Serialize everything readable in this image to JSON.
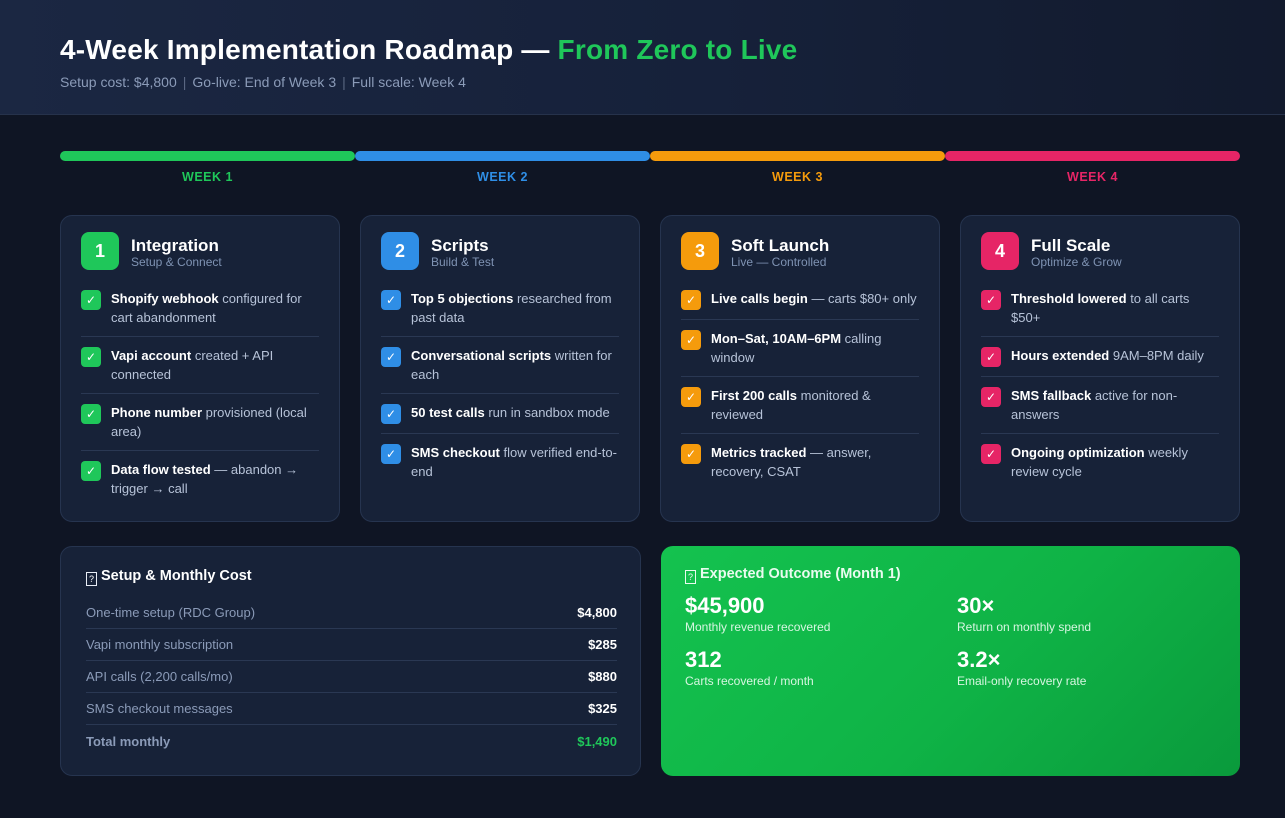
{
  "header": {
    "title_main": "4-Week Implementation Roadmap — ",
    "title_accent": "From Zero to Live",
    "subtitle_parts": [
      "Setup cost: $4,800",
      "Go-live: End of Week 3",
      "Full scale: Week 4"
    ],
    "separator": "|"
  },
  "timeline": [
    {
      "label": "WEEK 1",
      "color": "#1fc75a"
    },
    {
      "label": "WEEK 2",
      "color": "#2f8ee6"
    },
    {
      "label": "WEEK 3",
      "color": "#f59b0c"
    },
    {
      "label": "WEEK 4",
      "color": "#e62566"
    }
  ],
  "weeks": [
    {
      "number": "1",
      "title": "Integration",
      "subtitle": "Setup & Connect",
      "color": "#1fc75a",
      "check": "✓",
      "items": [
        {
          "bold": "Shopify webhook",
          "text": " configured for cart abandonment"
        },
        {
          "bold": "Vapi account",
          "text": " created + API connected"
        },
        {
          "bold": "Phone number",
          "text": " provisioned (local area)"
        },
        {
          "bold": "Data flow tested",
          "text": " — abandon → trigger → call"
        }
      ]
    },
    {
      "number": "2",
      "title": "Scripts",
      "subtitle": "Build & Test",
      "color": "#2f8ee6",
      "check": "✓",
      "items": [
        {
          "bold": "Top 5 objections",
          "text": " researched from past data"
        },
        {
          "bold": "Conversational scripts",
          "text": " written for each"
        },
        {
          "bold": "50 test calls",
          "text": " run in sandbox mode"
        },
        {
          "bold": "SMS checkout",
          "text": " flow verified end-to-end"
        }
      ]
    },
    {
      "number": "3",
      "title": "Soft Launch",
      "subtitle": "Live — Controlled",
      "color": "#f59b0c",
      "check": "✓",
      "items": [
        {
          "bold": "Live calls begin",
          "text": " — carts $80+ only"
        },
        {
          "bold": "Mon–Sat, 10AM–6PM",
          "text": " calling window"
        },
        {
          "bold": "First 200 calls",
          "text": " monitored & reviewed"
        },
        {
          "bold": "Metrics tracked",
          "text": " — answer, recovery, CSAT"
        }
      ]
    },
    {
      "number": "4",
      "title": "Full Scale",
      "subtitle": "Optimize & Grow",
      "color": "#e62566",
      "check": "✓",
      "items": [
        {
          "bold": "Threshold lowered",
          "text": " to all carts $50+"
        },
        {
          "bold": "Hours extended",
          "text": " 9AM–8PM daily"
        },
        {
          "bold": "SMS fallback",
          "text": " active for non-answers"
        },
        {
          "bold": "Ongoing optimization",
          "text": " weekly review cycle"
        }
      ]
    }
  ],
  "cost": {
    "icon_glyph": "?",
    "title": "Setup & Monthly Cost",
    "rows": [
      {
        "label": "One-time setup (RDC Group)",
        "value": "$4,800"
      },
      {
        "label": "Vapi monthly subscription",
        "value": "$285"
      },
      {
        "label": "API calls (2,200 calls/mo)",
        "value": "$880"
      },
      {
        "label": "SMS checkout messages",
        "value": "$325"
      }
    ],
    "total": {
      "label": "Total monthly",
      "value": "$1,490"
    }
  },
  "outcome": {
    "icon_glyph": "?",
    "title": "Expected Outcome (Month 1)",
    "metrics": [
      {
        "value": "$45,900",
        "caption": "Monthly revenue recovered"
      },
      {
        "value": "30×",
        "caption": "Return on monthly spend"
      },
      {
        "value": "312",
        "caption": "Carts recovered / month"
      },
      {
        "value": "3.2×",
        "caption": "Email-only recovery rate"
      }
    ]
  }
}
